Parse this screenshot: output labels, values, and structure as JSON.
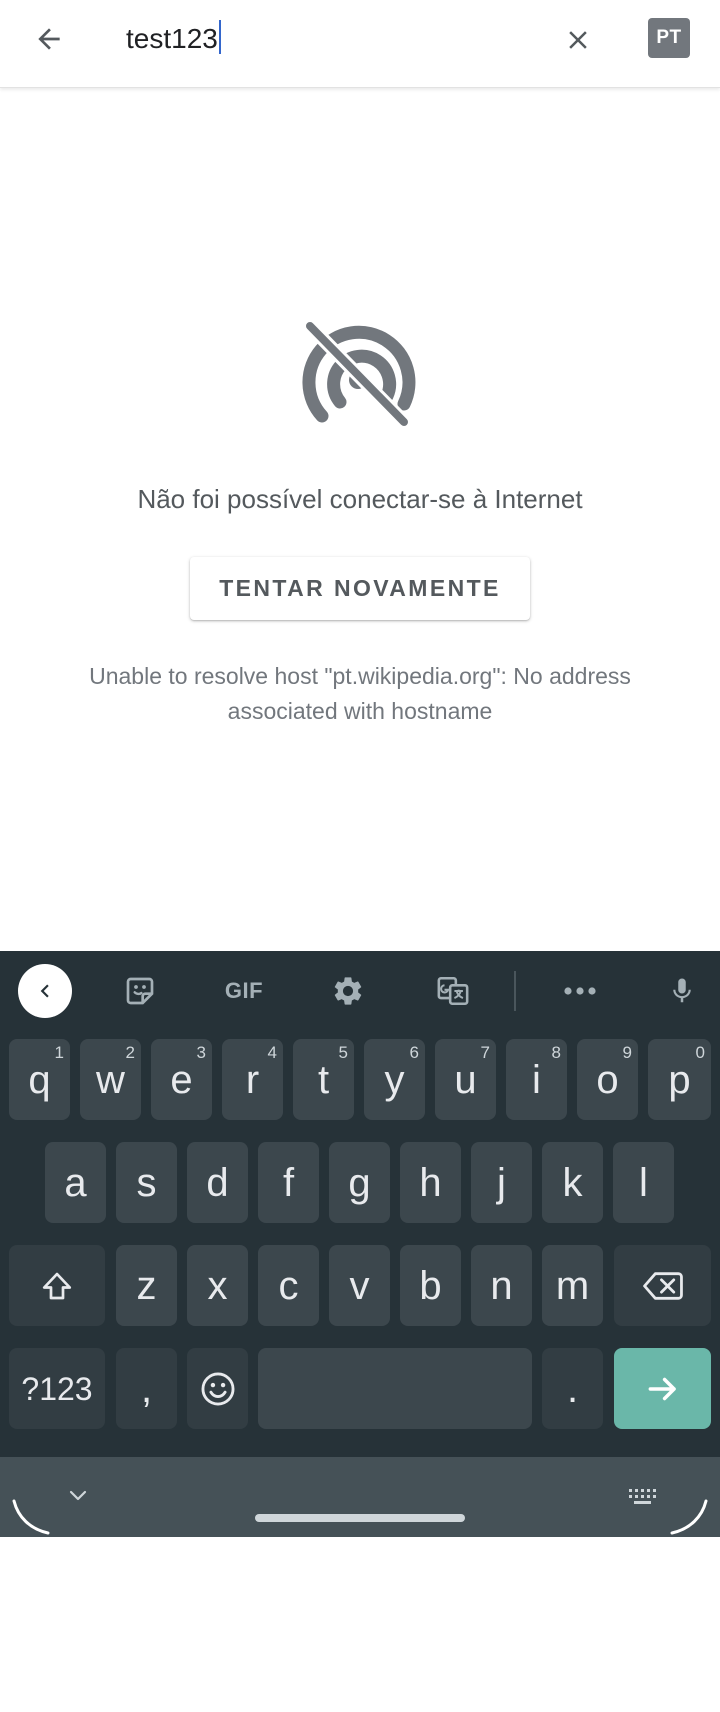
{
  "search": {
    "value": "test123",
    "language_badge": "PT"
  },
  "error": {
    "title": "Não foi possível conectar-se à Internet",
    "retry_label": "TENTAR NOVAMENTE",
    "detail": "Unable to resolve host \"pt.wikipedia.org\": No address associated with hostname"
  },
  "keyboard": {
    "toolbar": {
      "gif_label": "GIF",
      "icons": [
        "chevron-left-icon",
        "sticker-icon",
        "gif-icon",
        "settings-gear-icon",
        "translate-icon",
        "more-icon",
        "microphone-icon"
      ]
    },
    "rows": [
      [
        {
          "label": "q",
          "hint": "1"
        },
        {
          "label": "w",
          "hint": "2"
        },
        {
          "label": "e",
          "hint": "3"
        },
        {
          "label": "r",
          "hint": "4"
        },
        {
          "label": "t",
          "hint": "5"
        },
        {
          "label": "y",
          "hint": "6"
        },
        {
          "label": "u",
          "hint": "7"
        },
        {
          "label": "i",
          "hint": "8"
        },
        {
          "label": "o",
          "hint": "9"
        },
        {
          "label": "p",
          "hint": "0"
        }
      ],
      [
        {
          "label": "a"
        },
        {
          "label": "s"
        },
        {
          "label": "d"
        },
        {
          "label": "f"
        },
        {
          "label": "g"
        },
        {
          "label": "h"
        },
        {
          "label": "j"
        },
        {
          "label": "k"
        },
        {
          "label": "l"
        }
      ],
      [
        {
          "label": "z"
        },
        {
          "label": "x"
        },
        {
          "label": "c"
        },
        {
          "label": "v"
        },
        {
          "label": "b"
        },
        {
          "label": "n"
        },
        {
          "label": "m"
        }
      ]
    ],
    "symbols_label": "?123",
    "comma_label": ",",
    "period_label": "."
  },
  "colors": {
    "keyboard_bg": "#263238",
    "key_bg": "#3c474d",
    "enter_key": "#6ab7a9",
    "caret": "#3366cc",
    "badge_bg": "#72777d"
  }
}
